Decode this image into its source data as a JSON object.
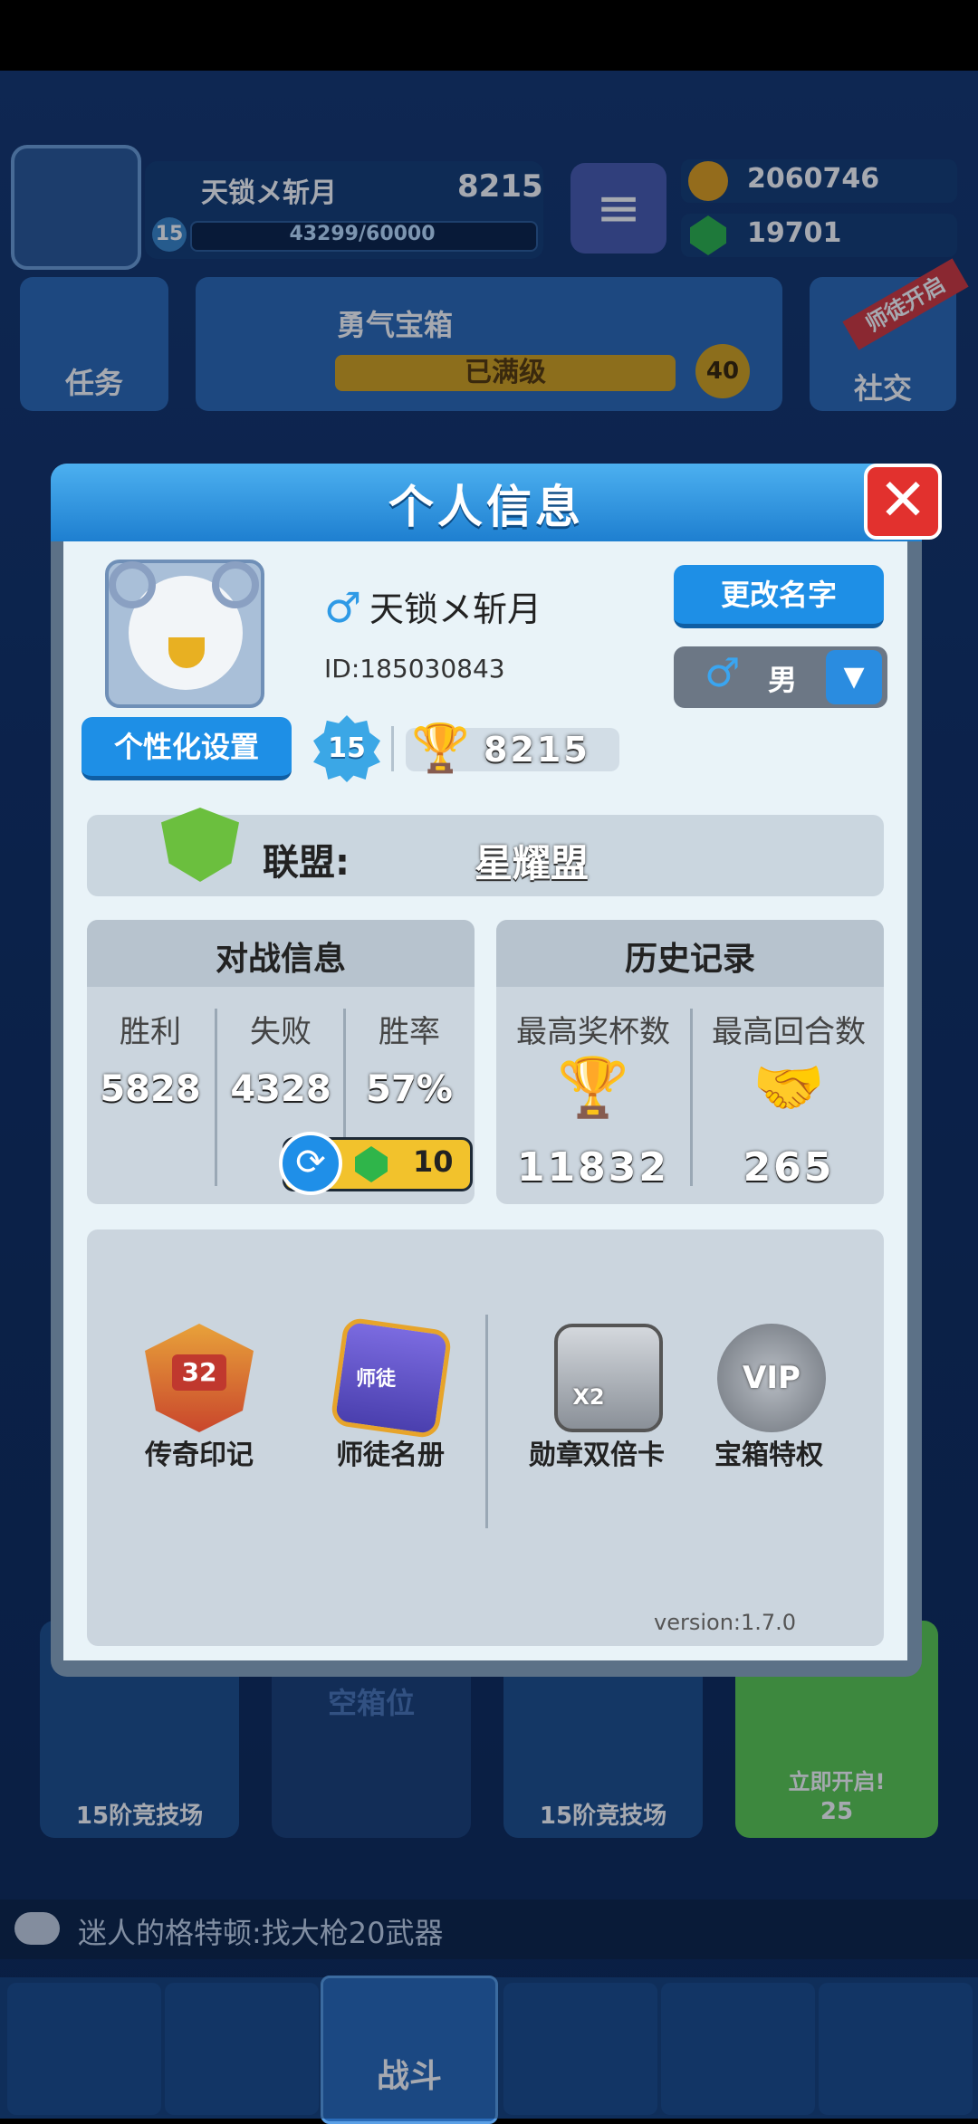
{
  "hud": {
    "player_name": "天锁メ斩月",
    "trophies": "8215",
    "level": "15",
    "xp": "43299/60000",
    "gold": "2060746",
    "gems": "19701",
    "task_label": "任务",
    "chest_title": "勇气宝箱",
    "chest_status": "已满级",
    "chest_level": "40",
    "social_label": "社交",
    "social_badge": "师徒开启"
  },
  "slots": [
    {
      "label": "15阶竞技场"
    },
    {
      "label": "空箱位"
    },
    {
      "label": "15阶竞技场"
    },
    {
      "label": "立即开启!",
      "cost": "25"
    }
  ],
  "chat": {
    "message": "迷人的格特顿:找大枪20武器"
  },
  "nav": {
    "fight_label": "战斗"
  },
  "modal": {
    "title": "个人信息",
    "close_symbol": "✕",
    "name": "天锁メ斩月",
    "gender_symbol": "♂",
    "id_text": "ID:185030843",
    "rename_label": "更改名字",
    "gender_value": "男",
    "customize_label": "个性化设置",
    "level": "15",
    "trophies": "8215",
    "alliance_label": "联盟:",
    "alliance_name": "星耀盟",
    "battle": {
      "title": "对战信息",
      "labels": [
        "胜利",
        "失败",
        "胜率"
      ],
      "values": [
        "5828",
        "4328",
        "57%"
      ],
      "refresh_cost": "10"
    },
    "history": {
      "title": "历史记录",
      "labels": [
        "最高奖杯数",
        "最高回合数"
      ],
      "values": [
        "11832",
        "265"
      ]
    },
    "features": [
      {
        "label": "传奇印记",
        "icon": "legend-badge-icon",
        "badge": "32"
      },
      {
        "label": "师徒名册",
        "icon": "mentor-book-icon",
        "badge": "师徒"
      },
      {
        "label": "勋章双倍卡",
        "icon": "medal-double-card-icon",
        "badge": "X2"
      },
      {
        "label": "宝箱特权",
        "icon": "vip-icon",
        "badge": "VIP"
      }
    ],
    "version": "version:1.7.0"
  },
  "colors": {
    "accent_blue": "#1e8fe6",
    "close_red": "#e2312e",
    "gold": "#e6a619",
    "gem_green": "#2fb54a"
  }
}
